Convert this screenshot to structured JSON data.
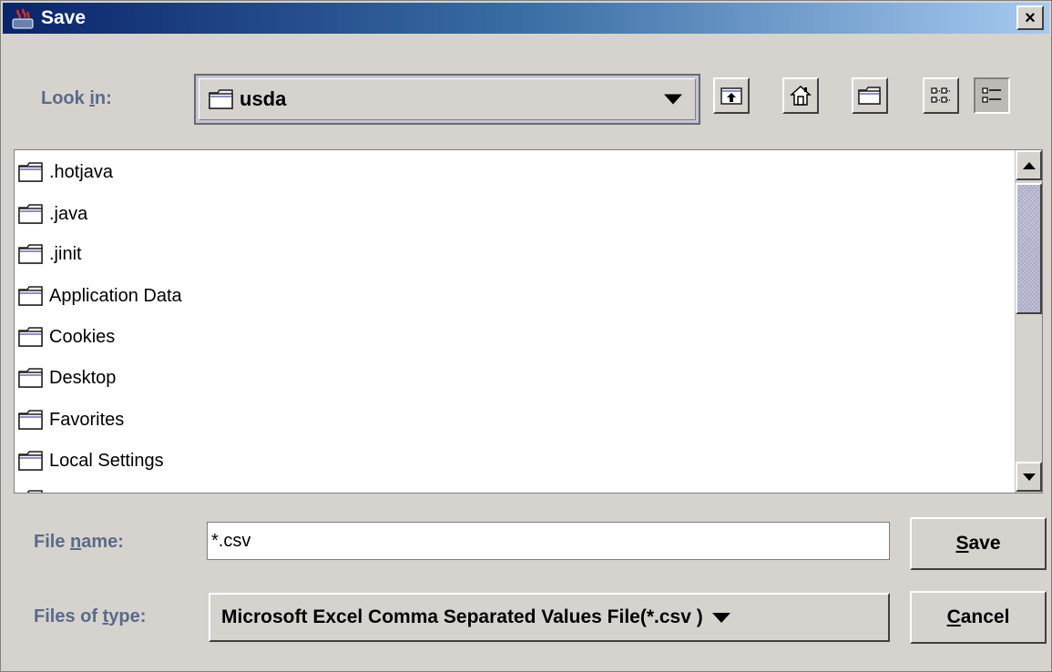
{
  "window": {
    "title": "Save",
    "close_label": "×"
  },
  "lookin": {
    "label_before": "Look ",
    "label_mnemonic": "i",
    "label_after": "n:",
    "value": "usda"
  },
  "toolbar": {
    "icons": [
      "up-one-level-icon",
      "home-icon",
      "new-folder-icon",
      "list-view-icon",
      "details-view-icon"
    ],
    "active_view": "details"
  },
  "files": [
    {
      "name": ".hotjava"
    },
    {
      "name": ".java"
    },
    {
      "name": ".jinit"
    },
    {
      "name": "Application Data"
    },
    {
      "name": "Cookies"
    },
    {
      "name": "Desktop"
    },
    {
      "name": "Favorites"
    },
    {
      "name": "Local Settings"
    }
  ],
  "filename": {
    "label_before": "File ",
    "label_mnemonic": "n",
    "label_after": "ame:",
    "value": "*.csv"
  },
  "filetype": {
    "label_before": "Files of ",
    "label_mnemonic": "t",
    "label_after": "ype:",
    "value": "Microsoft Excel Comma Separated Values File(*.csv )"
  },
  "buttons": {
    "save_mnemonic": "S",
    "save_rest": "ave",
    "cancel_mnemonic": "C",
    "cancel_rest": "ancel"
  },
  "colors": {
    "title_gradient_start": "#0a246a",
    "title_gradient_end": "#a6caf0",
    "label_text": "#5a6a8a",
    "dialog_bg": "#d6d3ce"
  }
}
